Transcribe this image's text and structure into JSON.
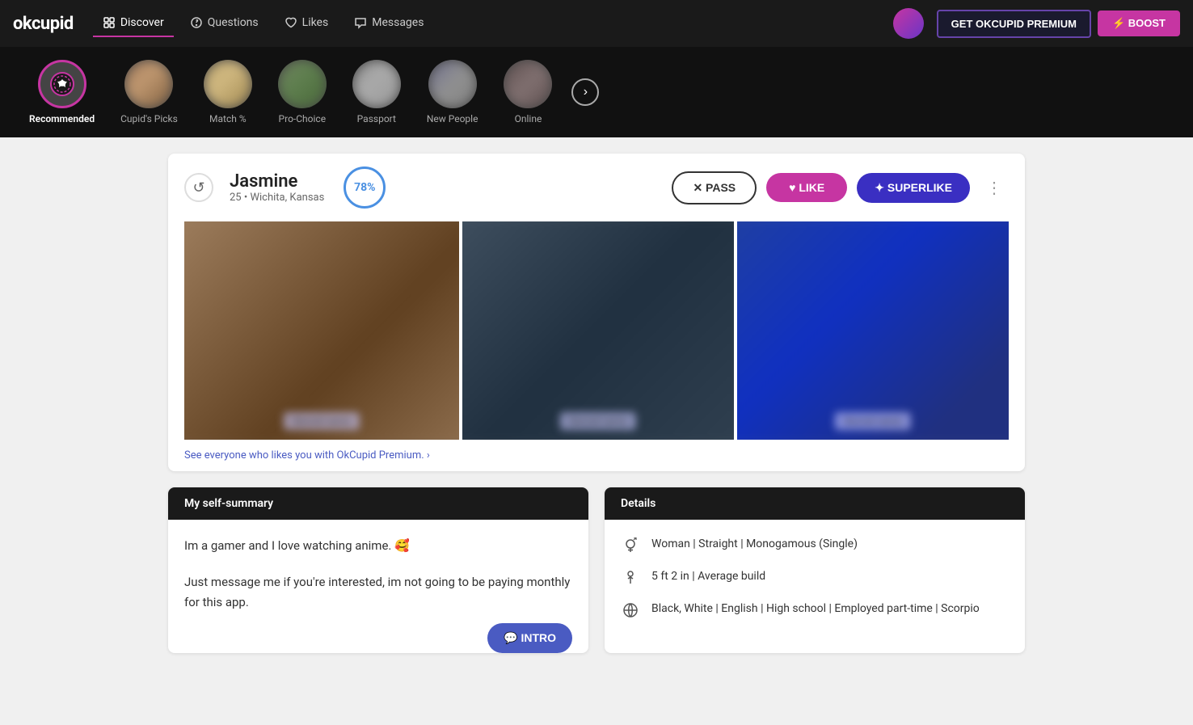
{
  "app": {
    "logo": "okcupid",
    "premium_btn": "GET OKCUPID PREMIUM",
    "boost_btn": "⚡ BOOST"
  },
  "nav": {
    "items": [
      {
        "id": "discover",
        "label": "Discover",
        "active": true
      },
      {
        "id": "questions",
        "label": "Questions"
      },
      {
        "id": "likes",
        "label": "Likes"
      },
      {
        "id": "messages",
        "label": "Messages"
      }
    ]
  },
  "categories": [
    {
      "id": "recommended",
      "label": "Recommended",
      "active": true,
      "type": "icon"
    },
    {
      "id": "cupids-picks",
      "label": "Cupid's Picks",
      "active": false,
      "type": "photo"
    },
    {
      "id": "match",
      "label": "Match %",
      "active": false,
      "type": "photo"
    },
    {
      "id": "pro-choice",
      "label": "Pro-Choice",
      "active": false,
      "type": "photo"
    },
    {
      "id": "passport",
      "label": "Passport",
      "active": false,
      "type": "photo"
    },
    {
      "id": "new-people",
      "label": "New People",
      "active": false,
      "type": "photo"
    },
    {
      "id": "online",
      "label": "Online",
      "active": false,
      "type": "photo"
    }
  ],
  "profile": {
    "name": "Jasmine",
    "age": "25",
    "location": "Wichita, Kansas",
    "match_percent": "78%",
    "premium_cta": "See everyone who likes you with OkCupid Premium. ›",
    "pass_label": "✕ PASS",
    "like_label": "♥ LIKE",
    "superlike_label": "✦ SUPERLIKE",
    "self_summary": {
      "header": "My self-summary",
      "text1": "Im a gamer and I love watching anime. 🥰",
      "text2": "Just message me if you're interested, im not going to be paying monthly for this app.",
      "intro_label": "💬 INTRO"
    },
    "details": {
      "header": "Details",
      "row1": "Woman | Straight | Monogamous (Single)",
      "row2": "5 ft 2 in | Average build",
      "row3": "Black, White | English | High school | Employed part-time | Scorpio"
    }
  }
}
